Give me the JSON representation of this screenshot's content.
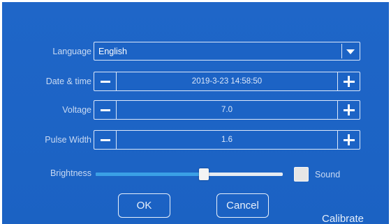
{
  "settings": {
    "language": {
      "label": "Language",
      "value": "English"
    },
    "datetime": {
      "label": "Date & time",
      "value": "2019-3-23 14:58:50"
    },
    "voltage": {
      "label": "Voltage",
      "value": "7.0"
    },
    "pulse_width": {
      "label": "Pulse Width",
      "value": "1.6"
    },
    "brightness": {
      "label": "Brightness",
      "level_fraction": 0.58
    },
    "sound": {
      "label": "Sound",
      "checked": false
    }
  },
  "buttons": {
    "ok": "OK",
    "cancel": "Cancel",
    "calibrate": "Calibrate"
  },
  "colors": {
    "background": "#1e64c4",
    "border": "#dce8fa",
    "slider_fill": "#3aa0e6",
    "text": "#c9daf3"
  }
}
